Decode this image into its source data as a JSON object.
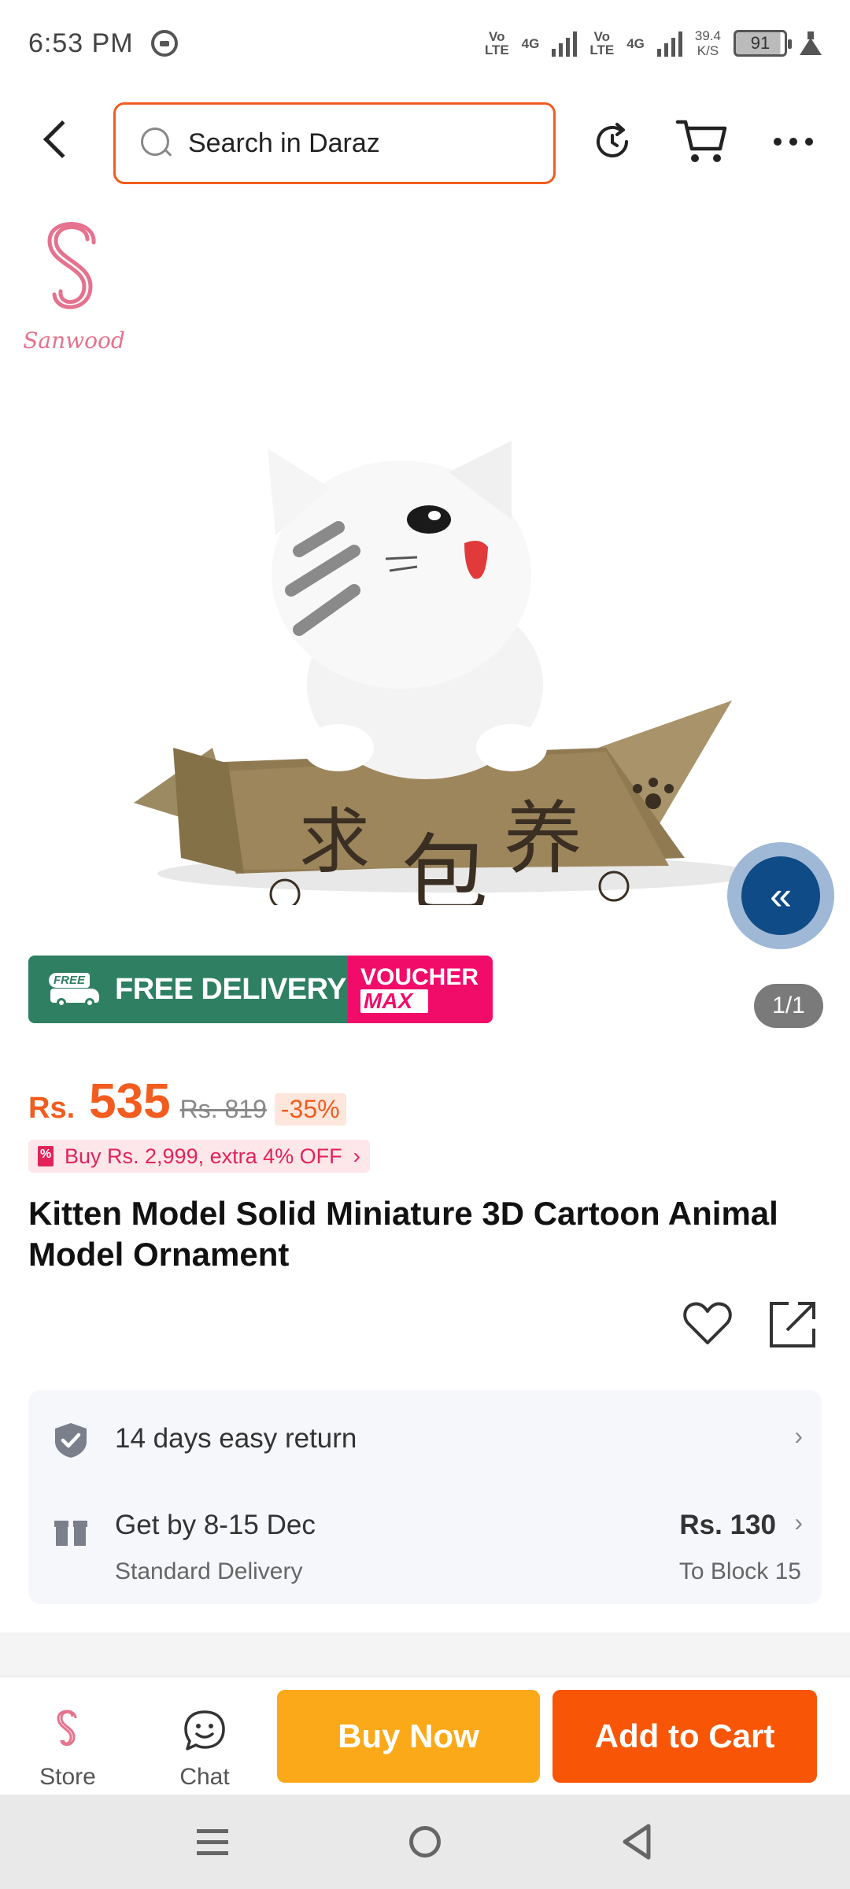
{
  "status_bar": {
    "time": "6:53 PM",
    "net1_top": "Vo",
    "net1_bottom": "LTE",
    "net1_gen": "4G",
    "net2_top": "Vo",
    "net2_bottom": "LTE",
    "net2_gen": "4G",
    "speed_value": "39.4",
    "speed_unit": "K/S",
    "battery": "91"
  },
  "header": {
    "search_placeholder": "Search in Daraz"
  },
  "gallery": {
    "brand_name": "Sanwood",
    "banner_free_tag": "FREE",
    "banner_free_text": "FREE DELIVERY",
    "banner_voucher_top": "VOUCHER",
    "banner_voucher_bottom": "MAX",
    "counter": "1/1"
  },
  "price": {
    "currency": "Rs.",
    "current": "535",
    "original": "Rs. 819",
    "discount": "-35%"
  },
  "promo": {
    "text": "Buy Rs. 2,999, extra 4% OFF"
  },
  "product": {
    "title": "Kitten Model Solid Miniature 3D Cartoon Animal Model Ornament"
  },
  "service": {
    "return_label": "14 days easy return",
    "delivery_label": "Get by 8-15 Dec",
    "delivery_type": "Standard Delivery",
    "delivery_fee": "Rs. 130",
    "delivery_destination": "To Block 15"
  },
  "action_bar": {
    "store_label": "Store",
    "chat_label": "Chat",
    "buy_now": "Buy Now",
    "add_to_cart": "Add to Cart"
  },
  "colors": {
    "accent": "#f85606",
    "buy_now": "#fba919",
    "free_delivery": "#2f7f63",
    "voucher": "#f20c6a"
  },
  "icons": [
    "back-icon",
    "search-icon",
    "refresh-icon",
    "cart-icon",
    "more-icon",
    "collapse-icon",
    "heart-icon",
    "share-icon",
    "shield-check-icon",
    "gift-box-icon",
    "chevron-right-icon",
    "store-logo-icon",
    "chat-icon"
  ]
}
